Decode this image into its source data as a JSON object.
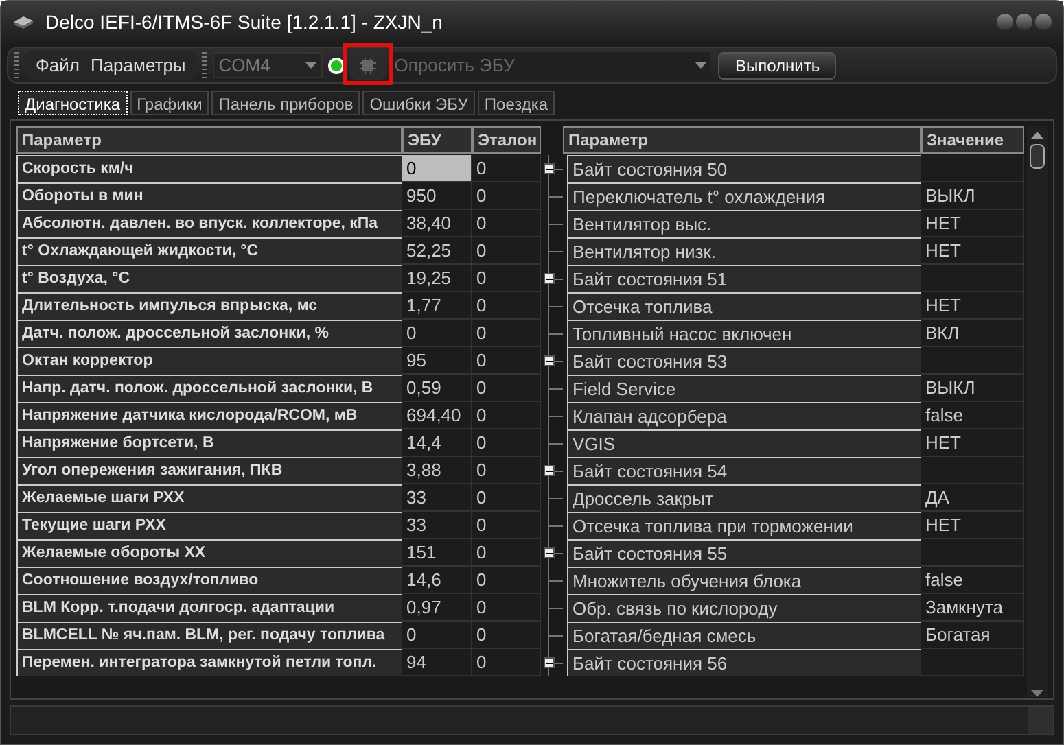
{
  "window": {
    "title": "Delco IEFI-6/ITMS-6F Suite [1.2.1.1] - ZXJN_n"
  },
  "menu": [
    "Файл",
    "Параметры"
  ],
  "toolbar": {
    "port": {
      "value": "COM4",
      "disabled": true
    },
    "connected": true,
    "poll_button": {
      "highlighted": true,
      "disabled": true
    },
    "command": {
      "value": "Опросить ЭБУ",
      "disabled": true
    },
    "run_button": "Выполнить"
  },
  "tabs": [
    {
      "label": "Диагностика",
      "selected": true
    },
    {
      "label": "Графики",
      "selected": false
    },
    {
      "label": "Панель приборов",
      "selected": false
    },
    {
      "label": "Ошибки ЭБУ",
      "selected": false
    },
    {
      "label": "Поездка",
      "selected": false
    }
  ],
  "left_table": {
    "columns": [
      "Параметр",
      "ЭБУ",
      "Эталон"
    ],
    "rows": [
      {
        "parameter": "Скорость км/ч",
        "ecu": "0",
        "reference": "0",
        "selected": true
      },
      {
        "parameter": "Обороты в мин",
        "ecu": "950",
        "reference": "0",
        "selected": false
      },
      {
        "parameter": "Абсолютн. давлен. во впуск. коллекторе, кПа",
        "ecu": "38,40",
        "reference": "0",
        "selected": false
      },
      {
        "parameter": "t° Охлаждающей жидкости, °C",
        "ecu": "52,25",
        "reference": "0",
        "selected": false
      },
      {
        "parameter": "t° Воздуха, °C",
        "ecu": "19,25",
        "reference": "0",
        "selected": false
      },
      {
        "parameter": "Длительность импулься впрыска, мс",
        "ecu": "1,77",
        "reference": "0",
        "selected": false
      },
      {
        "parameter": "Датч. полож. дроссельной заслонки, %",
        "ecu": "0",
        "reference": "0",
        "selected": false
      },
      {
        "parameter": "Октан корректор",
        "ecu": "95",
        "reference": "0",
        "selected": false
      },
      {
        "parameter": "Напр. датч. полож. дроссельной заслонки, В",
        "ecu": "0,59",
        "reference": "0",
        "selected": false
      },
      {
        "parameter": "Напряжение датчика кислорода/RCOM, мВ",
        "ecu": "694,40",
        "reference": "0",
        "selected": false
      },
      {
        "parameter": "Напряжение бортсети, В",
        "ecu": "14,4",
        "reference": "0",
        "selected": false
      },
      {
        "parameter": "Угол опережения зажигания, ПКВ",
        "ecu": "3,88",
        "reference": "0",
        "selected": false
      },
      {
        "parameter": "Желаемые шаги РХХ",
        "ecu": "33",
        "reference": "0",
        "selected": false
      },
      {
        "parameter": "Текущие шаги РХХ",
        "ecu": "33",
        "reference": "0",
        "selected": false
      },
      {
        "parameter": "Желаемые обороты ХХ",
        "ecu": "151",
        "reference": "0",
        "selected": false
      },
      {
        "parameter": "Соотношение воздух/топливо",
        "ecu": "14,6",
        "reference": "0",
        "selected": false
      },
      {
        "parameter": "BLM Корр. т.подачи долгоср. адаптации",
        "ecu": "0,97",
        "reference": "0",
        "selected": false
      },
      {
        "parameter": "BLMCELL № яч.пам. BLM, рег. подачу топлива",
        "ecu": "0",
        "reference": "0",
        "selected": false
      },
      {
        "parameter": "Перемен. интегратора замкнутой петли топл.",
        "ecu": "94",
        "reference": "0",
        "selected": false
      }
    ]
  },
  "right_table": {
    "columns": [
      "Параметр",
      "Значение"
    ],
    "rows": [
      {
        "parameter": "Байт состояния 50",
        "expanded": true,
        "children": [
          {
            "parameter": "Переключатель t° охлаждения",
            "value": "ВЫКЛ"
          },
          {
            "parameter": "Вентилятор выс.",
            "value": "НЕТ"
          },
          {
            "parameter": "Вентилятор низк.",
            "value": "НЕТ"
          }
        ]
      },
      {
        "parameter": "Байт состояния 51",
        "expanded": true,
        "children": [
          {
            "parameter": "Отсечка топлива",
            "value": "НЕТ"
          },
          {
            "parameter": "Топливный насос включен",
            "value": "ВКЛ"
          }
        ]
      },
      {
        "parameter": "Байт состояния 53",
        "expanded": true,
        "children": [
          {
            "parameter": "Field Service",
            "value": "ВЫКЛ"
          },
          {
            "parameter": "Клапан адсорбера",
            "value": "false"
          },
          {
            "parameter": "VGIS",
            "value": "НЕТ"
          }
        ]
      },
      {
        "parameter": "Байт состояния 54",
        "expanded": true,
        "children": [
          {
            "parameter": "Дроссель закрыт",
            "value": "ДА"
          },
          {
            "parameter": "Отсечка топлива при торможении",
            "value": "НЕТ"
          }
        ]
      },
      {
        "parameter": "Байт состояния 55",
        "expanded": true,
        "children": [
          {
            "parameter": "Множитель обучения блока",
            "value": "false"
          },
          {
            "parameter": "Обр. связь по кислороду",
            "value": "Замкнута"
          },
          {
            "parameter": "Богатая/бедная смесь",
            "value": "Богатая"
          }
        ]
      },
      {
        "parameter": "Байт состояния 56",
        "expanded": true
      }
    ]
  }
}
